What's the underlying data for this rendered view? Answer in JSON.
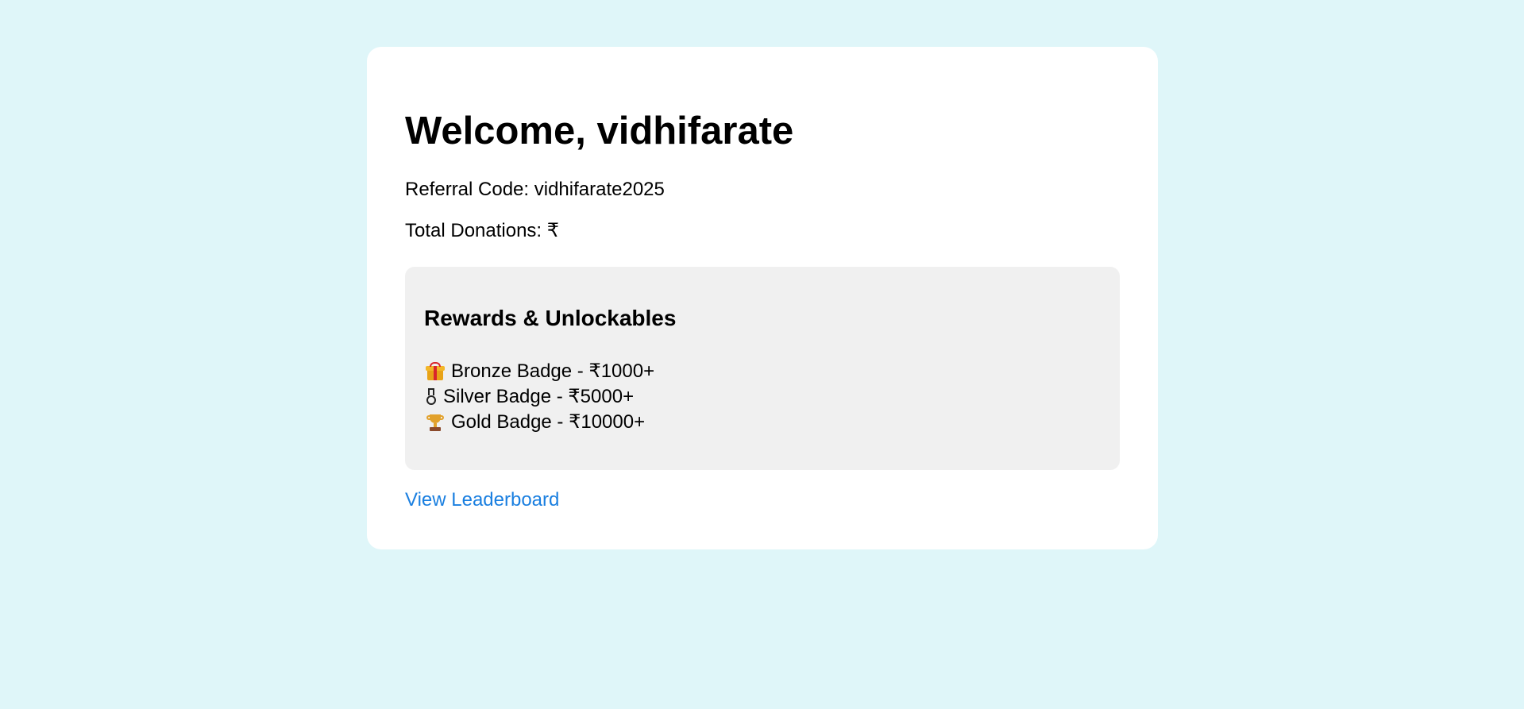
{
  "header": {
    "welcome_title": "Welcome, vidhifarate"
  },
  "user": {
    "referral_text": "Referral Code: vidhifarate2025",
    "donations_text": "Total Donations: ₹"
  },
  "rewards": {
    "title": "Rewards & Unlockables",
    "items": [
      {
        "icon": "gift-icon",
        "label": "Bronze Badge - ₹1000+"
      },
      {
        "icon": "medal-icon",
        "label": "Silver Badge - ₹5000+"
      },
      {
        "icon": "trophy-icon",
        "label": "Gold Badge - ₹10000+"
      }
    ]
  },
  "links": {
    "leaderboard": "View Leaderboard"
  },
  "colors": {
    "page_background": "#dff6f9",
    "card_background": "#ffffff",
    "rewards_background": "#f0f0f0",
    "link_color": "#1a7fe0"
  }
}
